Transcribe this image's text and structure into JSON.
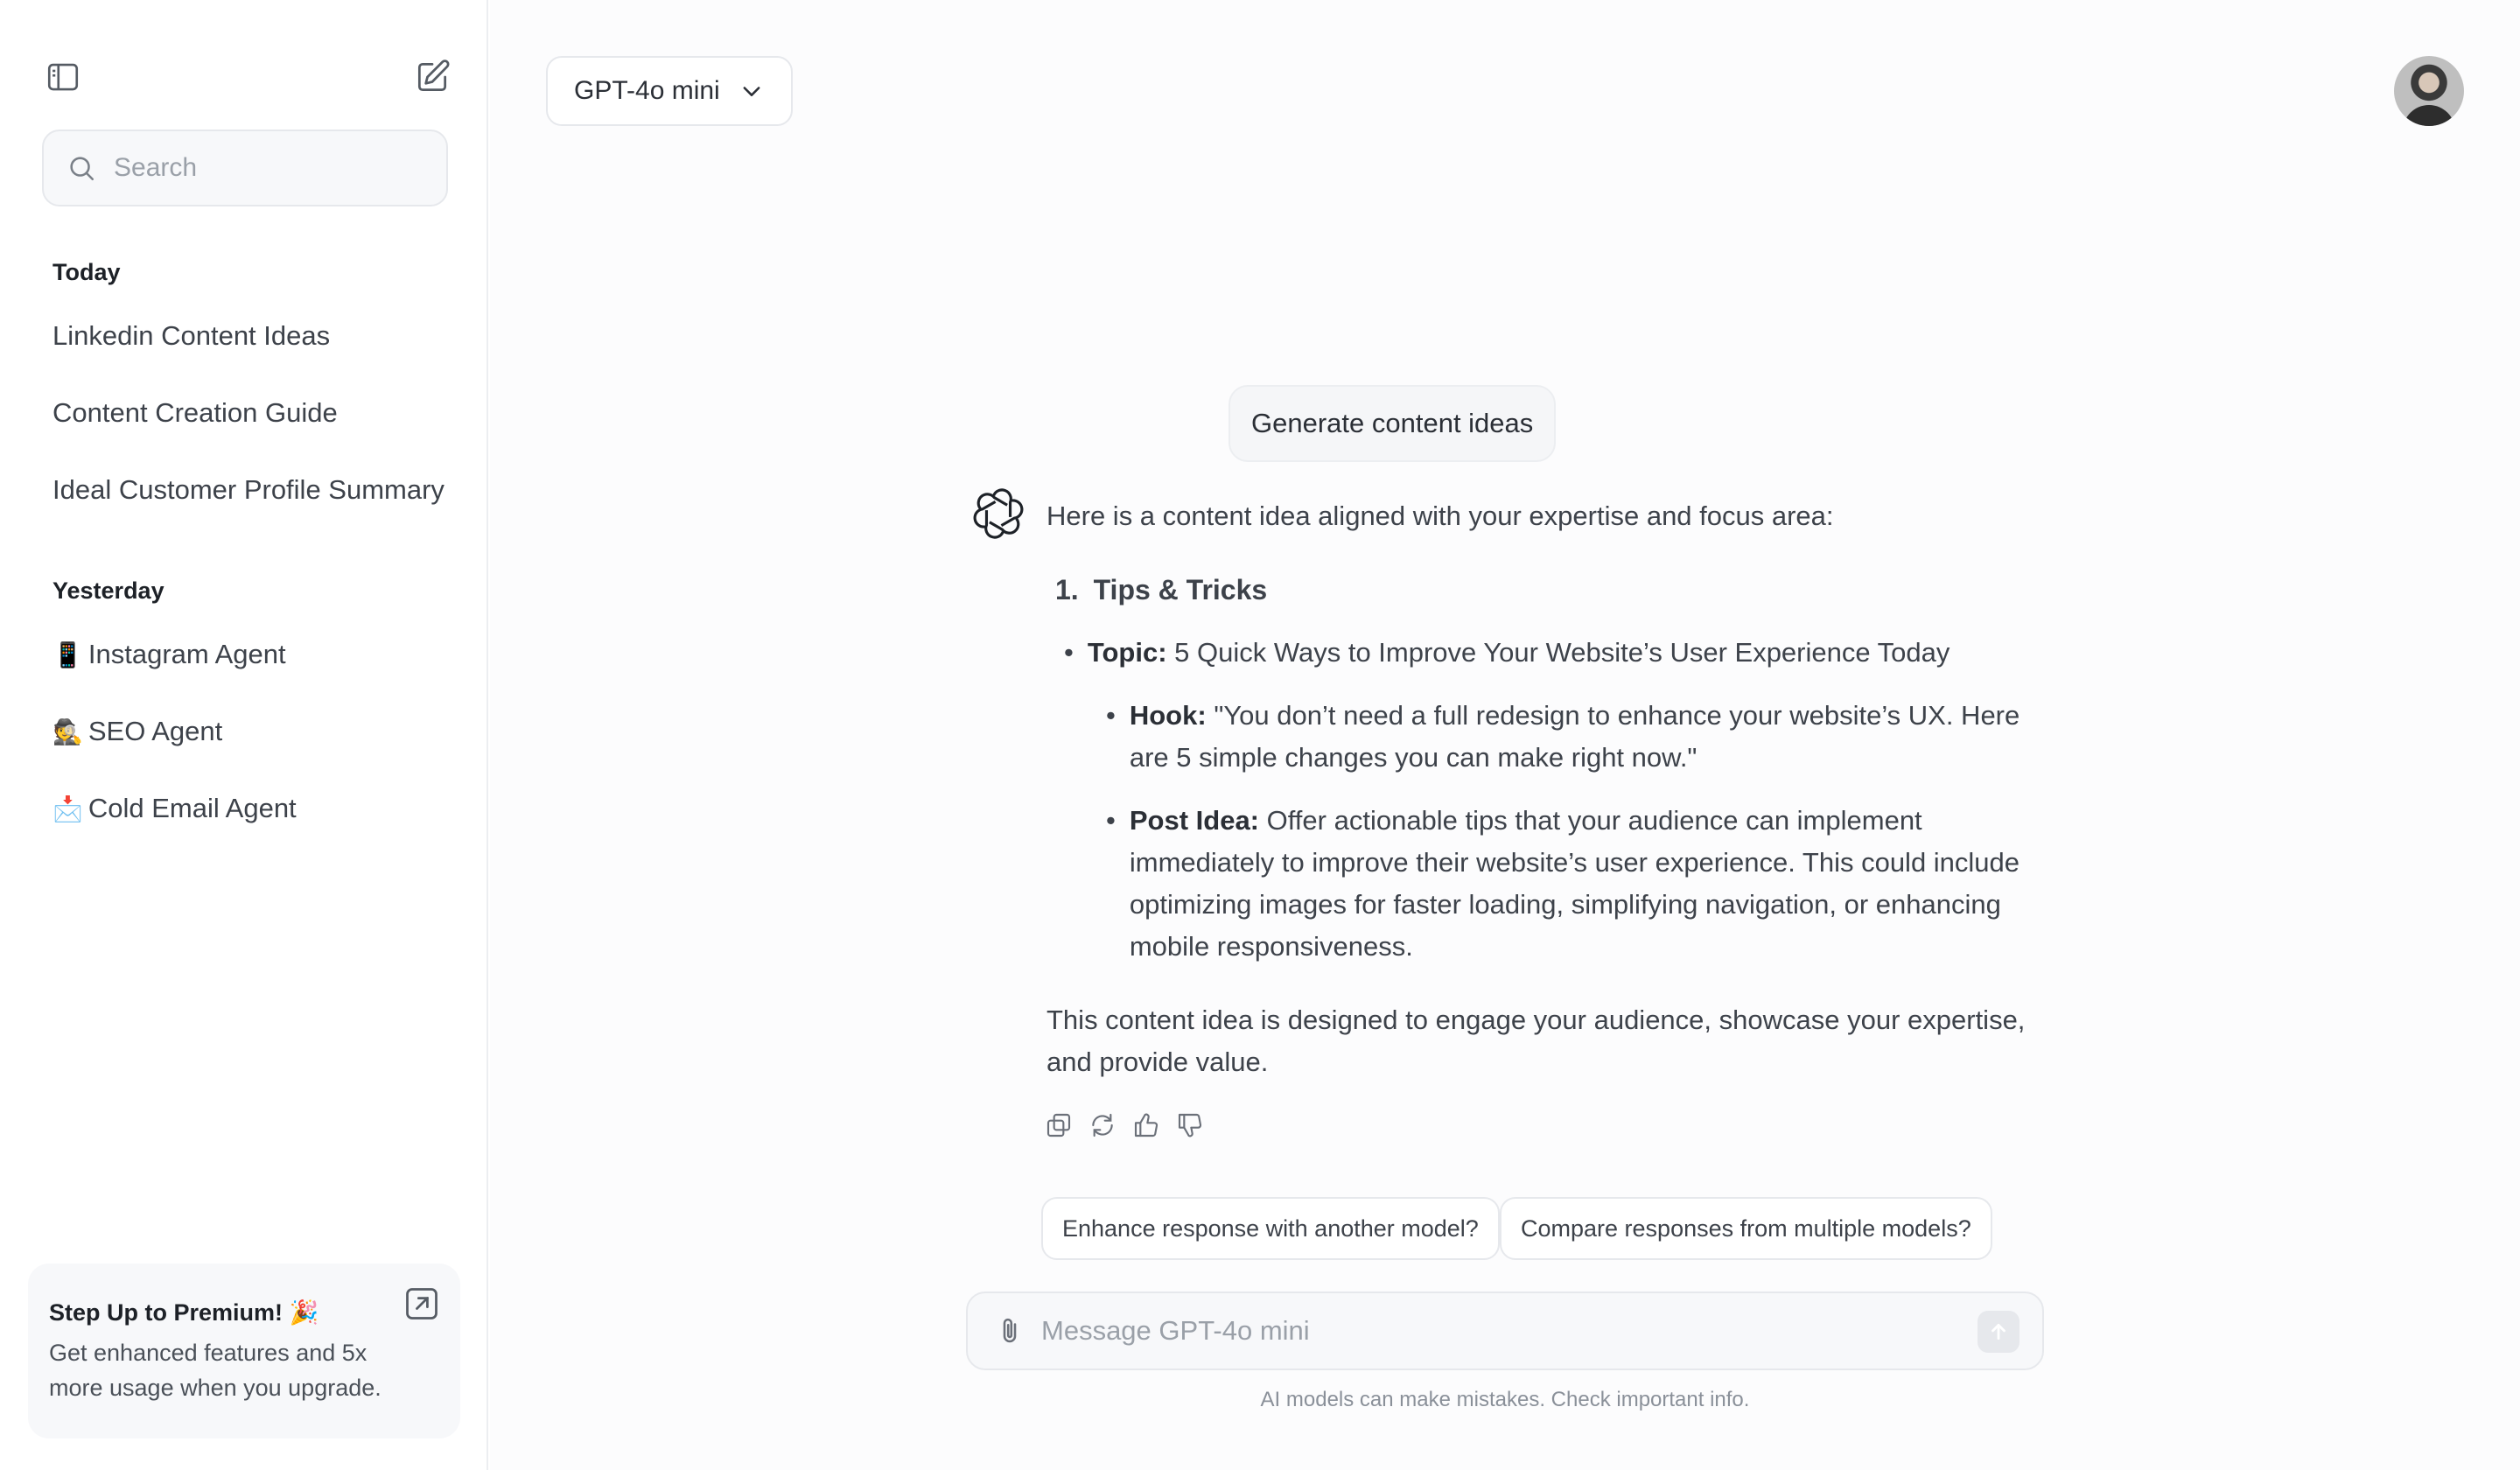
{
  "sidebar": {
    "search_placeholder": "Search",
    "groups": [
      {
        "title": "Today",
        "items": [
          {
            "label": "Linkedin Content Ideas"
          },
          {
            "label": "Content Creation Guide"
          },
          {
            "label": "Ideal Customer Profile Summary"
          }
        ]
      },
      {
        "title": "Yesterday",
        "items": [
          {
            "emoji": "📱",
            "label": "Instagram Agent"
          },
          {
            "emoji": "🕵️",
            "label": "SEO Agent"
          },
          {
            "emoji": "📩",
            "label": "Cold Email Agent"
          }
        ]
      }
    ],
    "premium": {
      "title": "Step Up to Premium! 🎉",
      "description": "Get enhanced features and 5x more usage when you upgrade."
    }
  },
  "header": {
    "model": "GPT-4o mini"
  },
  "chat": {
    "user_message": "Generate content ideas",
    "response": {
      "intro": "Here is a content idea aligned with your expertise and focus area:",
      "item_number": "1.",
      "item_title": "Tips & Tricks",
      "topic_label": "Topic:",
      "topic_text": "5 Quick Ways to Improve Your Website’s User Experience Today",
      "hook_label": "Hook:",
      "hook_text": "\"You don’t need a full redesign to enhance your website’s UX. Here are 5 simple changes you can make right now.\"",
      "post_label": "Post Idea:",
      "post_text": "Offer actionable tips that your audience can implement immediately to improve their website’s user experience. This could include optimizing images for faster loading, simplifying navigation, or enhancing mobile responsiveness.",
      "outro": "This content idea is designed to engage your audience, showcase your expertise, and provide value."
    },
    "suggestions": [
      "Enhance response with another model?",
      "Compare responses from multiple models?"
    ]
  },
  "composer": {
    "placeholder": "Message GPT-4o mini",
    "disclaimer": "AI models can make mistakes. Check important info."
  }
}
